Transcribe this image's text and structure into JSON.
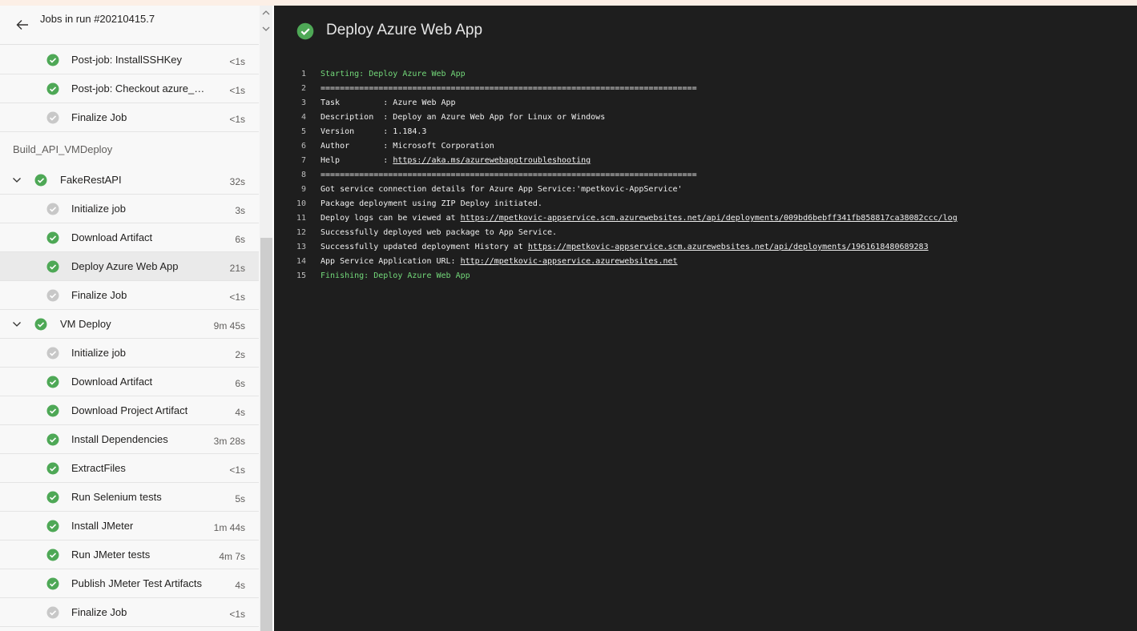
{
  "header": {
    "title": "Jobs in run #20210415.7"
  },
  "colors": {
    "success": "#4ea856",
    "skipped": "#c8c8c8",
    "log_bg": "#1e1e1e",
    "log_green": "#73d97a"
  },
  "steps_top": [
    {
      "label": "Post-job: InstallSSHKey",
      "duration": "<1s",
      "status": "success"
    },
    {
      "label": "Post-job: Checkout azure_E...",
      "duration": "<1s",
      "status": "success"
    },
    {
      "label": "Finalize Job",
      "duration": "<1s",
      "status": "skipped"
    }
  ],
  "stage": {
    "name": "Build_API_VMDeploy"
  },
  "jobs": [
    {
      "name": "FakeRestAPI",
      "duration": "32s",
      "status": "success",
      "steps": [
        {
          "label": "Initialize job",
          "duration": "3s",
          "status": "skipped"
        },
        {
          "label": "Download Artifact",
          "duration": "6s",
          "status": "success"
        },
        {
          "label": "Deploy Azure Web App",
          "duration": "21s",
          "status": "success",
          "selected": true
        },
        {
          "label": "Finalize Job",
          "duration": "<1s",
          "status": "skipped"
        }
      ]
    },
    {
      "name": "VM Deploy",
      "duration": "9m 45s",
      "status": "success",
      "steps": [
        {
          "label": "Initialize job",
          "duration": "2s",
          "status": "skipped"
        },
        {
          "label": "Download Artifact",
          "duration": "6s",
          "status": "success"
        },
        {
          "label": "Download Project Artifact",
          "duration": "4s",
          "status": "success"
        },
        {
          "label": "Install Dependencies",
          "duration": "3m 28s",
          "status": "success"
        },
        {
          "label": "ExtractFiles",
          "duration": "<1s",
          "status": "success"
        },
        {
          "label": "Run Selenium tests",
          "duration": "5s",
          "status": "success"
        },
        {
          "label": "Install JMeter",
          "duration": "1m 44s",
          "status": "success"
        },
        {
          "label": "Run JMeter tests",
          "duration": "4m 7s",
          "status": "success"
        },
        {
          "label": "Publish JMeter Test Artifacts",
          "duration": "4s",
          "status": "success"
        },
        {
          "label": "Finalize Job",
          "duration": "<1s",
          "status": "skipped"
        }
      ]
    }
  ],
  "detail": {
    "title": "Deploy Azure Web App",
    "status": "success",
    "log": [
      {
        "num": "1",
        "text": "Starting: Deploy Azure Web App",
        "style": "green"
      },
      {
        "num": "2",
        "text": "=============================================================================="
      },
      {
        "num": "3",
        "text": "Task         : Azure Web App"
      },
      {
        "num": "4",
        "text": "Description  : Deploy an Azure Web App for Linux or Windows"
      },
      {
        "num": "5",
        "text": "Version      : 1.184.3"
      },
      {
        "num": "6",
        "text": "Author       : Microsoft Corporation"
      },
      {
        "num": "7",
        "text": "Help         : ",
        "link": "https://aka.ms/azurewebapptroubleshooting"
      },
      {
        "num": "8",
        "text": "=============================================================================="
      },
      {
        "num": "9",
        "text": "Got service connection details for Azure App Service:'mpetkovic-AppService'"
      },
      {
        "num": "10",
        "text": "Package deployment using ZIP Deploy initiated."
      },
      {
        "num": "11",
        "text": "Deploy logs can be viewed at ",
        "link": "https://mpetkovic-appservice.scm.azurewebsites.net/api/deployments/009bd6bebff341fb858817ca38082ccc/log"
      },
      {
        "num": "12",
        "text": "Successfully deployed web package to App Service."
      },
      {
        "num": "13",
        "text": "Successfully updated deployment History at ",
        "link": "https://mpetkovic-appservice.scm.azurewebsites.net/api/deployments/1961618480689283"
      },
      {
        "num": "14",
        "text": "App Service Application URL: ",
        "link": "http://mpetkovic-appservice.azurewebsites.net"
      },
      {
        "num": "15",
        "text": "Finishing: Deploy Azure Web App",
        "style": "green"
      }
    ]
  }
}
